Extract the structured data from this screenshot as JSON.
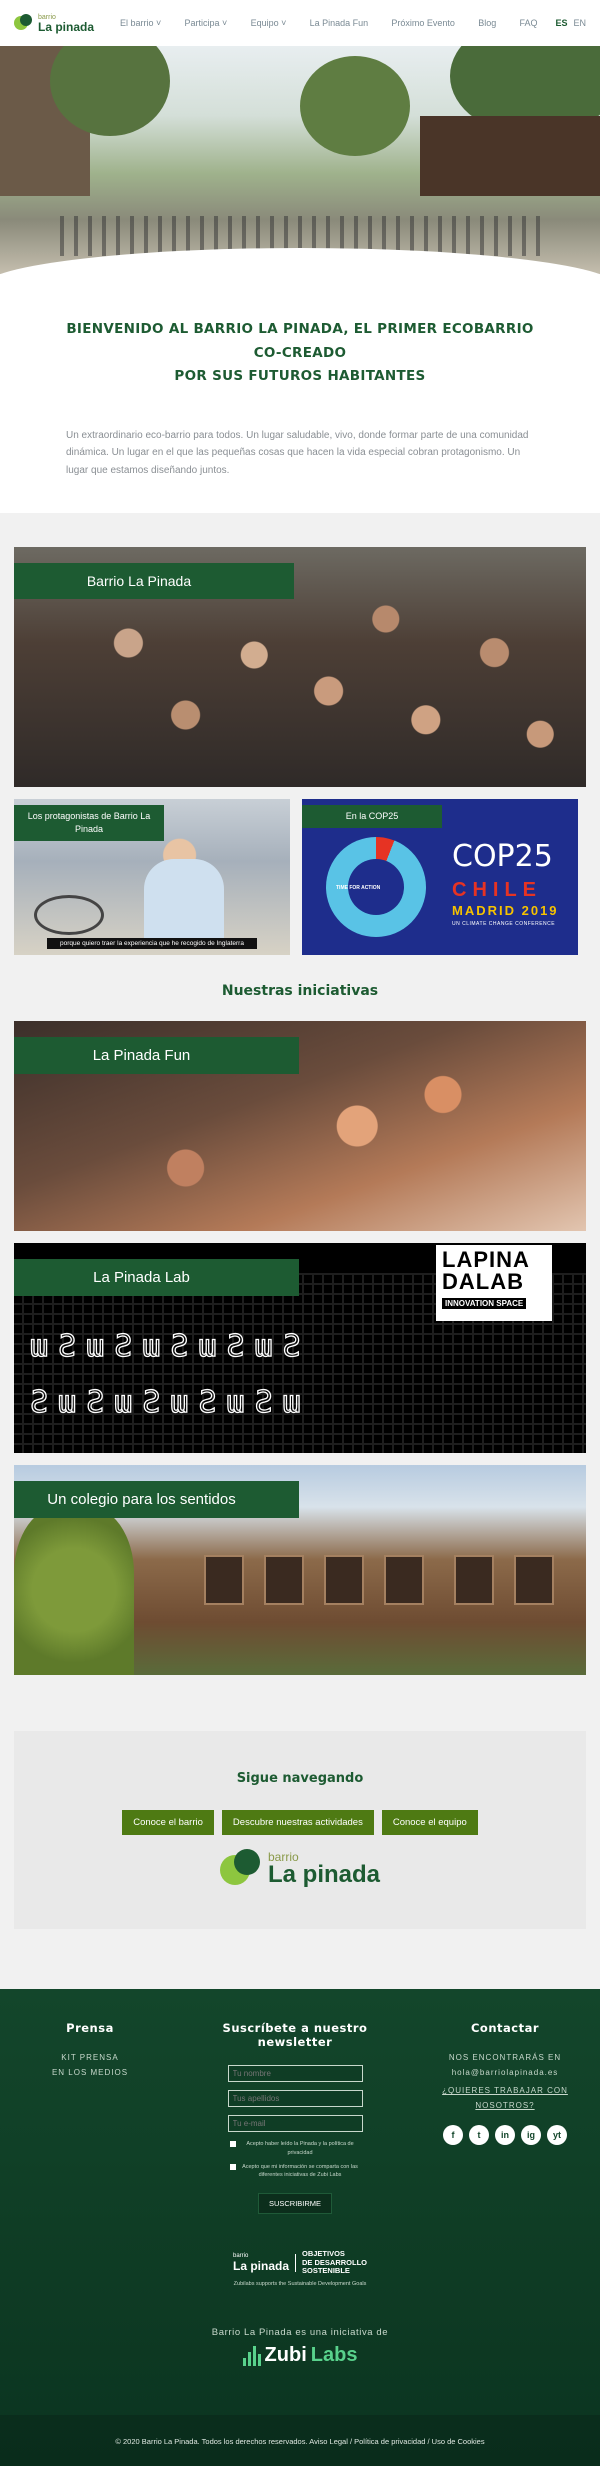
{
  "nav": {
    "logo_small": "barrio",
    "logo_big": "La pinada",
    "items": [
      "El barrio",
      "Participa",
      "Equipo",
      "La Pinada Fun",
      "Próximo Evento",
      "Blog",
      "FAQ"
    ],
    "lang_es": "ES",
    "lang_en": "EN"
  },
  "welcome": {
    "title_line1": "BIENVENIDO AL BARRIO LA PINADA,  EL PRIMER ECOBARRIO CO-CREADO",
    "title_line2": "POR SUS FUTUROS HABITANTES",
    "text": "Un extraordinario eco-barrio para todos. Un lugar saludable, vivo, donde formar parte de una comunidad dinámica. Un lugar en el que las pequeñas cosas que hacen la vida especial cobran protagonismo. Un lugar que estamos diseñando juntos."
  },
  "cards": {
    "barrio": "Barrio La Pinada",
    "protagonistas": "Los protagonistas de Barrio La Pinada",
    "protagonistas_subtitle": "porque quiero traer la experiencia que he recogido de Inglaterra",
    "cop": "En la COP25",
    "cop_title": "COP25",
    "cop_country": "CHILE",
    "cop_city": "MADRID 2019",
    "cop_sub": "UN CLIMATE CHANGE CONFERENCE",
    "cop_slogan": "TIME FOR ACTION"
  },
  "initiatives": {
    "title": "Nuestras iniciativas",
    "fun": "La Pinada Fun",
    "lab": "La Pinada Lab",
    "lab_badge_1": "LAPINA",
    "lab_badge_2": "DALAB",
    "lab_badge_3": "INNOVATION  SPACE",
    "colegio": "Un colegio para los sentidos"
  },
  "sigue": {
    "title": "Sigue navegando",
    "btn1": "Conoce el barrio",
    "btn2": "Descubre nuestras actividades",
    "btn3": "Conoce el equipo",
    "logo_small": "barrio",
    "logo_big": "La pinada"
  },
  "footer": {
    "prensa_title": "Prensa",
    "prensa_link1": "KIT PRENSA",
    "prensa_link2": "EN LOS MEDIOS",
    "news_title": "Suscríbete a nuestro newsletter",
    "ph_name": "Tu nombre",
    "ph_surname": "Tus apellidos",
    "ph_email": "Tu e-mail",
    "chk1": "Acepto haber leído la Pinada y la política de privacidad",
    "chk2": "Acepto que mi información se comparta con las diferentes iniciativas de Zubi Labs",
    "subscribe": "SUSCRIBIRME",
    "contact_title": "Contactar",
    "contact_text": "NOS ENCONTRARÁS EN",
    "contact_email": "hola@barriolapinada.es",
    "contact_work": "¿QUIERES TRABAJAR CON NOSOTROS?",
    "social": [
      "f",
      "t",
      "in",
      "ig",
      "yt"
    ],
    "ods_small": "barrio",
    "ods_big": "La pinada",
    "ods_1": "OBJETIVOS",
    "ods_2": "DE DESARROLLO",
    "ods_3": "SOSTENIBLE",
    "ods_sub": "Zubilabs supports the Sustainable Development Goals",
    "zubi_text": "Barrio La Pinada es una iniciativa de",
    "zubi_1": "Zubi",
    "zubi_2": "Labs",
    "copyright": "© 2020 Barrio La Pinada. Todos los derechos reservados. Aviso Legal / Política de privacidad / Uso de Cookies"
  }
}
